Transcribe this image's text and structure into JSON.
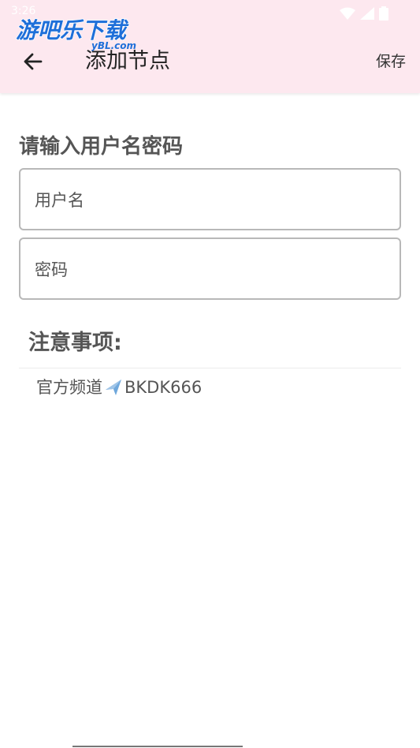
{
  "status_bar": {
    "time": "3:26"
  },
  "watermark": {
    "main": "游吧乐下载",
    "sub": "yBL.com"
  },
  "header": {
    "title": "添加节点",
    "save_label": "保存"
  },
  "form": {
    "heading": "请输入用户名密码",
    "username_placeholder": "用户名",
    "password_placeholder": "密码"
  },
  "notes": {
    "heading": "注意事项:",
    "line_prefix": "官方频道",
    "line_suffix": "BKDK666"
  },
  "colors": {
    "appbar_bg": "#fde8ef",
    "heading_text": "#555555",
    "field_border": "#b8b8b8",
    "watermark_blue": "#1e6fd9"
  }
}
